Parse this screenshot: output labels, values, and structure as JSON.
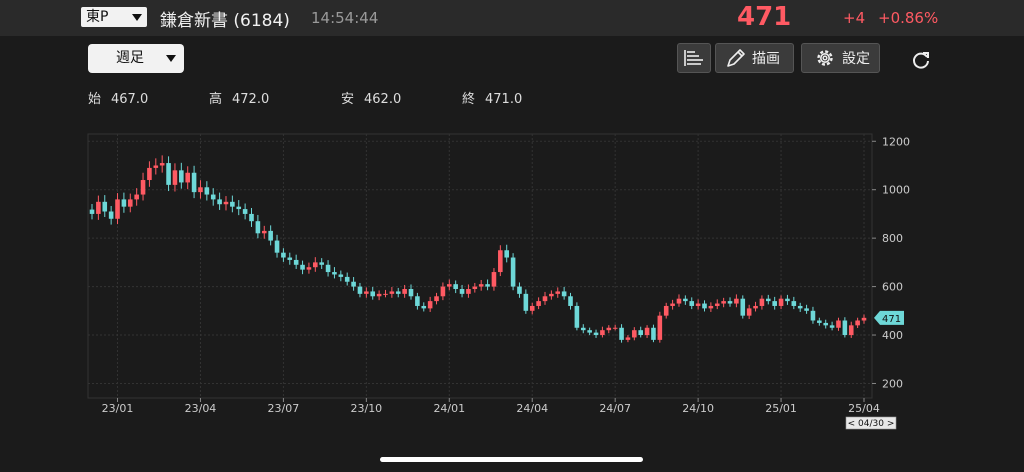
{
  "header": {
    "market": "東P",
    "stock_name": "鎌倉新書",
    "code": "(6184)",
    "time": "14:54:44",
    "price": "471",
    "change": "+4",
    "change_pct": "+0.86%"
  },
  "toolbar": {
    "period": "週足",
    "draw_label": "描画",
    "settings_label": "設定"
  },
  "ohlc": {
    "open_label": "始",
    "open": "467.0",
    "high_label": "高",
    "high": "472.0",
    "low_label": "安",
    "low": "462.0",
    "close_label": "終",
    "close": "471.0"
  },
  "colors": {
    "up": "#ff5a63",
    "down": "#6ed8d8",
    "accent": "#ff5a63",
    "background": "#1b1b1b"
  },
  "icons": {
    "list": "list-lines-icon",
    "draw": "pencil-icon",
    "settings": "gear-icon",
    "reload": "reload-icon"
  },
  "chart_data": {
    "type": "candlestick",
    "y_ticks": [
      200,
      400,
      600,
      800,
      1000,
      1200
    ],
    "ylim": [
      140,
      1230
    ],
    "x_ticks": [
      {
        "label": "23/01",
        "i": 4
      },
      {
        "label": "23/04",
        "i": 17
      },
      {
        "label": "23/07",
        "i": 30
      },
      {
        "label": "23/10",
        "i": 43
      },
      {
        "label": "24/01",
        "i": 56
      },
      {
        "label": "24/04",
        "i": 69
      },
      {
        "label": "24/07",
        "i": 82
      },
      {
        "label": "24/10",
        "i": 95
      },
      {
        "label": "25/01",
        "i": 108
      },
      {
        "label": "25/04",
        "i": 121
      }
    ],
    "current_price_label": "471",
    "current_price": 471,
    "date_cursor_label": "< 04/30 >",
    "close": [
      900,
      950,
      910,
      880,
      960,
      930,
      960,
      980,
      1040,
      1090,
      1100,
      1110,
      1020,
      1080,
      1030,
      1070,
      990,
      1010,
      980,
      960,
      940,
      950,
      930,
      920,
      900,
      870,
      820,
      830,
      790,
      740,
      720,
      710,
      690,
      670,
      680,
      700,
      690,
      660,
      650,
      640,
      620,
      600,
      570,
      580,
      560,
      570,
      570,
      580,
      570,
      590,
      560,
      520,
      510,
      540,
      560,
      600,
      610,
      590,
      570,
      590,
      600,
      610,
      600,
      660,
      750,
      720,
      600,
      570,
      500,
      520,
      540,
      560,
      570,
      580,
      560,
      520,
      430,
      420,
      410,
      400,
      420,
      430,
      430,
      380,
      390,
      420,
      400,
      430,
      380,
      480,
      520,
      530,
      550,
      540,
      520,
      530,
      510,
      520,
      530,
      540,
      530,
      550,
      480,
      510,
      520,
      550,
      540,
      520,
      550,
      540,
      520,
      510,
      500,
      460,
      450,
      440,
      430,
      460,
      400,
      440,
      460,
      471
    ]
  }
}
